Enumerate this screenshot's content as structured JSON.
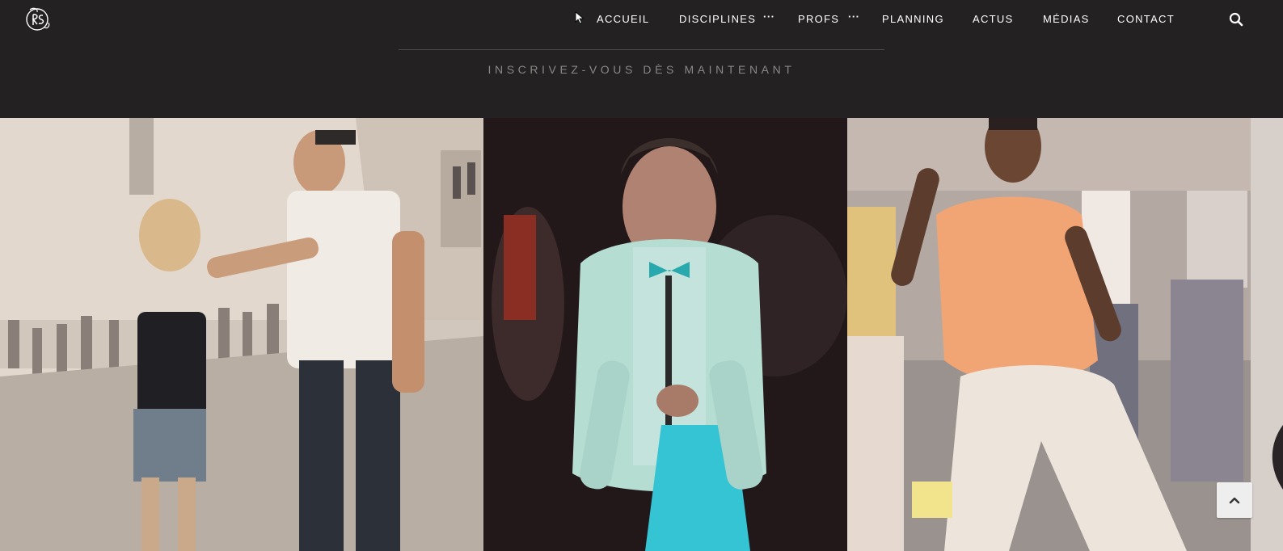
{
  "header": {
    "logo_alt": "RS",
    "nav": {
      "items": [
        {
          "label": "ACCUEIL"
        },
        {
          "label": "DISCIPLINES"
        },
        {
          "label": "PROFS"
        },
        {
          "label": "PLANNING"
        },
        {
          "label": "ACTUS"
        },
        {
          "label": "MÉDIAS"
        },
        {
          "label": "CONTACT"
        }
      ],
      "more_label": "···"
    },
    "cta": "INSCRIVEZ-VOUS DÈS MAINTENANT"
  },
  "icons": {
    "logo": "logo-icon",
    "search": "search-icon",
    "scroll_top": "chevron-up-icon",
    "cursor": "mouse-cursor-icon"
  },
  "colors": {
    "background": "#232121",
    "nav_text": "#ffffff",
    "cta_text": "#8b8786",
    "divider": "#4e4b4b",
    "scroll_button": "#eeeeee"
  }
}
